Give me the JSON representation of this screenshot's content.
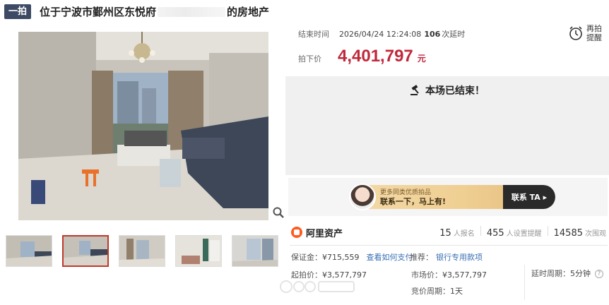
{
  "header": {
    "badge": "一拍",
    "title_prefix": "位于宁波市鄞州区东悦府",
    "title_suffix": "的房地产"
  },
  "auction": {
    "end_label": "结束时间",
    "end_time": "2026/04/24 12:24:08",
    "delay_count": "106",
    "delay_label": "次延时",
    "remind_line1": "再拍",
    "remind_line2": "提醒",
    "price_label": "拍下价",
    "price": "4,401,797",
    "price_unit": "元",
    "status": "本场已结束！"
  },
  "promo": {
    "line1": "更多同类优质拍品",
    "line2": "联系一下，马上有!",
    "cta": "联系 TA ▸"
  },
  "stats": {
    "brand": "阿里资产",
    "signups": "15",
    "signups_label": "人报名",
    "reminders": "455",
    "reminders_label": "人设置提醒",
    "views": "14585",
    "views_label": "次围观"
  },
  "details": {
    "deposit_label": "保证金：",
    "deposit": "¥715,559",
    "pay_link": "查看如何支付",
    "recommend_label": "推荐：",
    "recommend_link": "银行专用款项",
    "start_price_label": "起拍价：",
    "start_price": "¥3,577,797",
    "market_price_label": "市场价：",
    "market_price": "¥3,577,797",
    "delay_period_label": "延时周期：",
    "delay_period": "5分钟",
    "bid_period_label": "竞价周期：",
    "bid_period": "1天"
  },
  "colors": {
    "price_red": "#c0283b",
    "badge_bg": "#3d4a64",
    "link_blue": "#3a6fb4",
    "brand_orange": "#ff5a1f"
  }
}
